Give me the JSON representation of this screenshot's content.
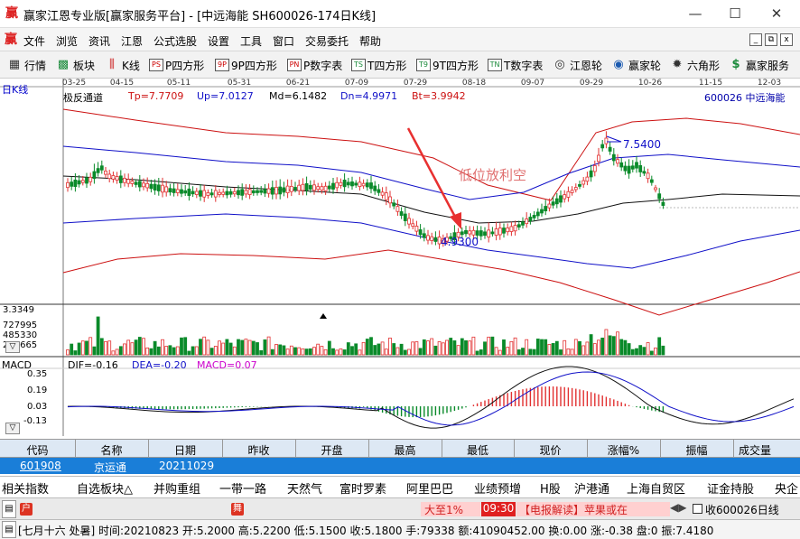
{
  "window": {
    "title": "赢家江恩专业版[赢家服务平台] - [中远海能  SH600026-174日K线]",
    "minimize": "—",
    "maximize": "☐",
    "close": "✕"
  },
  "menu": {
    "items": [
      "文件",
      "浏览",
      "资讯",
      "江恩",
      "公式选股",
      "设置",
      "工具",
      "窗口",
      "交易委托",
      "帮助"
    ],
    "mdi_minimize": "_",
    "mdi_restore": "⧉",
    "mdi_close": "x"
  },
  "toolbar": {
    "items": [
      {
        "label": "行情",
        "icon": "grid-icon",
        "glyph": "▦"
      },
      {
        "label": "板块",
        "icon": "blocks-icon",
        "glyph": "▩"
      },
      {
        "label": "K线",
        "icon": "candles-icon",
        "glyph": "⫼"
      },
      {
        "label": "P四方形",
        "icon": "ps-icon",
        "glyph": "PS"
      },
      {
        "label": "9P四方形",
        "icon": "9p-icon",
        "glyph": "9P"
      },
      {
        "label": "P数字表",
        "icon": "pn-icon",
        "glyph": "PN"
      },
      {
        "label": "T四方形",
        "icon": "ts-icon",
        "glyph": "TS"
      },
      {
        "label": "9T四方形",
        "icon": "t9-icon",
        "glyph": "T9"
      },
      {
        "label": "T数字表",
        "icon": "tn-icon",
        "glyph": "TN"
      },
      {
        "label": "江恩轮",
        "icon": "wheel-icon",
        "glyph": "◎"
      },
      {
        "label": "赢家轮",
        "icon": "winner-wheel-icon",
        "glyph": "◉"
      },
      {
        "label": "六角形",
        "icon": "hexagon-icon",
        "glyph": "✹"
      },
      {
        "label": "赢家服务",
        "icon": "dollar-icon",
        "glyph": "$"
      }
    ]
  },
  "kchart": {
    "period_label": "日K线",
    "indicator_name": "极反通道",
    "tp": "Tp=7.7709",
    "up": "Up=7.0127",
    "md": "Md=6.1482",
    "dn": "Dn=4.9971",
    "bt": "Bt=3.9942",
    "stock_label": "600026  中远海能",
    "date_ticks": [
      "03-25",
      "04-15",
      "05-11",
      "05-31",
      "06-21",
      "07-09",
      "07-29",
      "08-18",
      "09-07",
      "09-29",
      "10-26",
      "11-15",
      "12-03"
    ],
    "high_marker": "7.5400",
    "low_marker": "4.9300",
    "annotation": "低位放利空",
    "colors": {
      "up": "#e23030",
      "down": "#0a8a2a",
      "band_red": "#cc1111",
      "band_blue": "#1010c8",
      "band_black": "#111111"
    }
  },
  "volume": {
    "ticks": [
      "3.3349",
      "727995",
      "485330",
      "242665"
    ]
  },
  "macd": {
    "title": "MACD",
    "dif": "DIF=-0.16",
    "dea": "DEA=-0.20",
    "macd": "MACD=0.07",
    "ticks": [
      "0.35",
      "0.19",
      "0.03",
      "-0.13"
    ]
  },
  "quote_table": {
    "headers": [
      "代码",
      "名称",
      "日期",
      "昨收",
      "开盘",
      "最高",
      "最低",
      "现价",
      "涨幅%",
      "振幅",
      "成交量"
    ],
    "row": {
      "code": "601908",
      "name": "京运通",
      "date": "20211029"
    }
  },
  "tags": [
    "相关指数",
    "自选板块△",
    "并购重组",
    "一带一路",
    "天然气",
    "富时罗素",
    "阿里巴巴",
    "业绩预增",
    "H股",
    "沪港通",
    "上海自贸区",
    "证金持股",
    "央企"
  ],
  "status": {
    "icon_left": "户",
    "icon_mid": "舞",
    "ticker_text1": "大至1%",
    "ticker_time": "09:30",
    "ticker_text2": "【电报解读】苹果或在",
    "collect": "收600026日线"
  },
  "bottom_status": "[七月十六 处暑] 时间:20210823 开:5.2000 高:5.2200 低:5.1500 收:5.1800 手:79338 额:41090452.00 换:0.00 涨:-0.38 盘:0 振:7.4180"
}
